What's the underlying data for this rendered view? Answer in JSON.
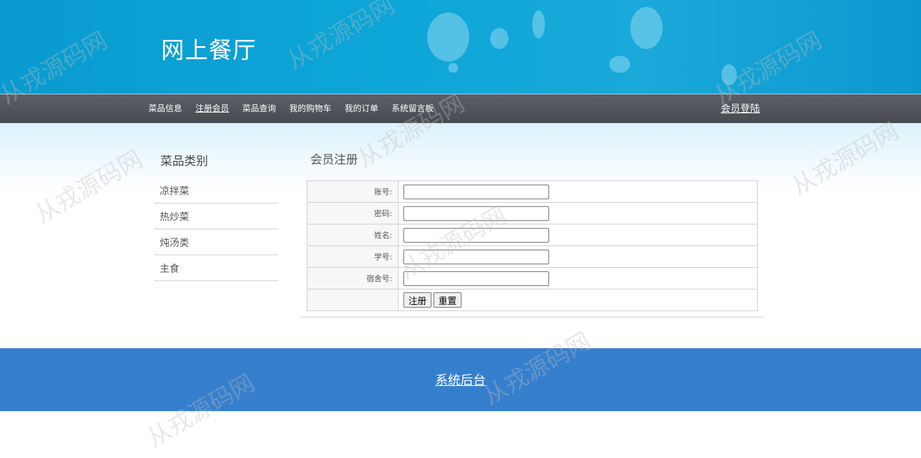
{
  "header": {
    "site_title": "网上餐厅"
  },
  "nav": {
    "items": [
      {
        "label": "菜品信息",
        "active": false
      },
      {
        "label": "注册会员",
        "active": true
      },
      {
        "label": "菜品查询",
        "active": false
      },
      {
        "label": "我的购物车",
        "active": false
      },
      {
        "label": "我的订单",
        "active": false
      },
      {
        "label": "系统留言板",
        "active": false
      }
    ],
    "login_label": "会员登陆"
  },
  "sidebar": {
    "title": "菜品类别",
    "categories": [
      "凉拌菜",
      "热炒菜",
      "炖汤类",
      "主食"
    ]
  },
  "form": {
    "title": "会员注册",
    "fields": [
      {
        "label": "账号:",
        "value": ""
      },
      {
        "label": "密码:",
        "value": ""
      },
      {
        "label": "姓名:",
        "value": ""
      },
      {
        "label": "学号:",
        "value": ""
      },
      {
        "label": "宿舍号:",
        "value": ""
      }
    ],
    "submit_label": "注册",
    "reset_label": "重置"
  },
  "footer": {
    "admin_link": "系统后台"
  },
  "watermark": "从戎源码网",
  "colors": {
    "banner": "#0ea6d8",
    "navbar": "#4f5359",
    "footer": "#367fcd"
  }
}
